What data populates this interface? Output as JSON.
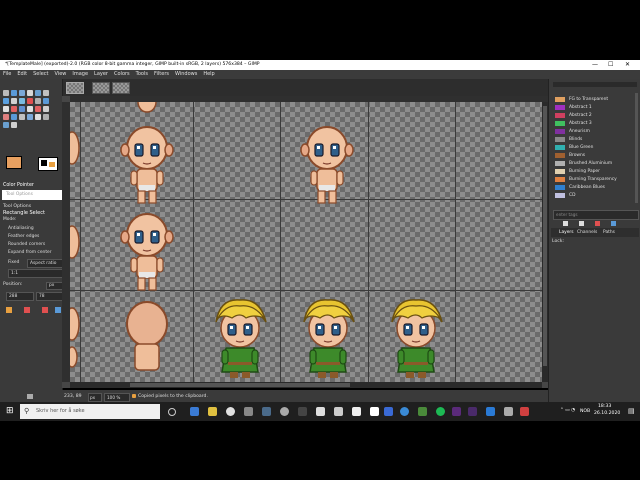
{
  "window": {
    "title": "*[TemplateMale] (exported)-2.0 (RGB color 8-bit gamma integer, GIMP built-in sRGB, 2 layers) 576x384 – GIMP",
    "minimize": "—",
    "maximize": "☐",
    "close": "✕"
  },
  "menu": [
    "File",
    "Edit",
    "Select",
    "View",
    "Image",
    "Layer",
    "Colors",
    "Tools",
    "Filters",
    "Windows",
    "Help"
  ],
  "left_dock": {
    "color_picker_label": "Color Pointer",
    "tool_options_tab": "Tool Options",
    "tool_options_header": "Tool Options",
    "rect_select_title": "Rectangle Select",
    "mode_label": "Mode:",
    "antialiasing": "Antialiasing",
    "feather_edges": "Feather edges",
    "rounded_corners": "Rounded corners",
    "expand_from_center": "Expand from center",
    "fixed_label": "Fixed",
    "aspect_ratio": "Aspect ratio",
    "ratio_value": "1:1",
    "position_label": "Position:",
    "position_unit": "px",
    "pos_x": "288",
    "pos_y": "78",
    "colors": {
      "fg": "#e8a060",
      "bg": "#f0c080"
    }
  },
  "status": {
    "coords": "233, 89",
    "unit": "px",
    "zoom": "100 %",
    "message": "Copied pixels to the clipboard."
  },
  "gradients": [
    {
      "name": "FG to Transparent",
      "color": "#e0a060"
    },
    {
      "name": "Abstract 1",
      "color": "#a030c0"
    },
    {
      "name": "Abstract 2",
      "color": "#d04060"
    },
    {
      "name": "Abstract 3",
      "color": "#40c060"
    },
    {
      "name": "Aneurism",
      "color": "#8030a0"
    },
    {
      "name": "Blinds",
      "color": "#8a8a8a"
    },
    {
      "name": "Blue Green",
      "color": "#30b0b0"
    },
    {
      "name": "Browns",
      "color": "#a06030"
    },
    {
      "name": "Brushed Aluminium",
      "color": "#b0b0b0"
    },
    {
      "name": "Burning Paper",
      "color": "#e0d0b0"
    },
    {
      "name": "Burning Transparency",
      "color": "#e08040"
    },
    {
      "name": "Caribbean Blues",
      "color": "#3080d0"
    },
    {
      "name": "CD",
      "color": "#c0c0e0"
    }
  ],
  "right_dock": {
    "filter_placeholder": "enter tags",
    "tabs": [
      "Layers",
      "Channels",
      "Paths"
    ],
    "lock_label": "Lock:"
  },
  "taskbar": {
    "search_placeholder": "Skriv her for å søke",
    "time": "18:33",
    "date": "26.10.2020",
    "lang": "NOB"
  }
}
